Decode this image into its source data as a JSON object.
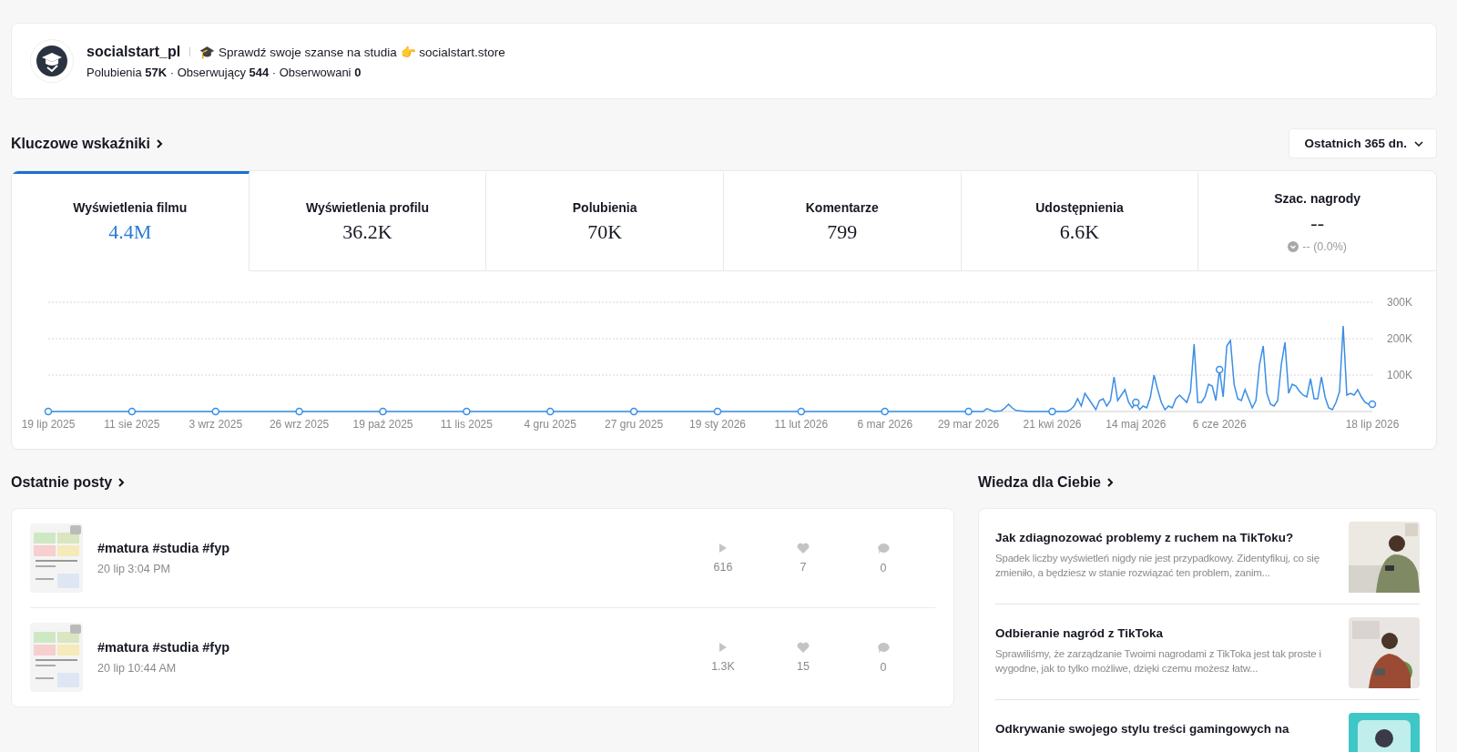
{
  "profile": {
    "username": "socialstart_pl",
    "bio": "🎓 Sprawdź swoje szanse na studia 👉 socialstart.store",
    "stats": "Polubienia **57K** · Obserwujący **544** · Obserwowani **0**"
  },
  "key_metrics": {
    "heading": "Kluczowe wskaźniki",
    "period": "Ostatnich 365 dn.",
    "metrics": [
      {
        "label": "Wyświetlenia filmu",
        "value": "4.4M",
        "selected": true
      },
      {
        "label": "Wyświetlenia profilu",
        "value": "36.2K",
        "selected": false
      },
      {
        "label": "Polubienia",
        "value": "70K",
        "selected": false
      },
      {
        "label": "Komentarze",
        "value": "799",
        "selected": false
      },
      {
        "label": "Udostępnienia",
        "value": "6.6K",
        "selected": false
      },
      {
        "label": "Szac. nagrody",
        "value": "--",
        "change": "-- (0.0%)",
        "selected": false
      }
    ],
    "chart_data": {
      "type": "line",
      "categories": [
        "19 lip 2025",
        null,
        null,
        null,
        null,
        null,
        null,
        null,
        null,
        null,
        null,
        null,
        null,
        null,
        null,
        null,
        null,
        null,
        null,
        null,
        null,
        null,
        null,
        "11 sie 2025",
        null,
        null,
        null,
        null,
        null,
        null,
        null,
        null,
        null,
        null,
        null,
        null,
        null,
        null,
        null,
        null,
        null,
        null,
        null,
        null,
        null,
        null,
        "3 wrz 2025",
        null,
        null,
        null,
        null,
        null,
        null,
        null,
        null,
        null,
        null,
        null,
        null,
        null,
        null,
        null,
        null,
        null,
        null,
        null,
        null,
        null,
        null,
        "26 wrz 2025",
        null,
        null,
        null,
        null,
        null,
        null,
        null,
        null,
        null,
        null,
        null,
        null,
        null,
        null,
        null,
        null,
        null,
        null,
        null,
        null,
        null,
        null,
        "19 paź 2025",
        null,
        null,
        null,
        null,
        null,
        null,
        null,
        null,
        null,
        null,
        null,
        null,
        null,
        null,
        null,
        null,
        null,
        null,
        null,
        null,
        null,
        null,
        "11 lis 2025",
        null,
        null,
        null,
        null,
        null,
        null,
        null,
        null,
        null,
        null,
        null,
        null,
        null,
        null,
        null,
        null,
        null,
        null,
        null,
        null,
        null,
        null,
        "4 gru 2025",
        null,
        null,
        null,
        null,
        null,
        null,
        null,
        null,
        null,
        null,
        null,
        null,
        null,
        null,
        null,
        null,
        null,
        null,
        null,
        null,
        null,
        null,
        "27 gru 2025",
        null,
        null,
        null,
        null,
        null,
        null,
        null,
        null,
        null,
        null,
        null,
        null,
        null,
        null,
        null,
        null,
        null,
        null,
        null,
        null,
        null,
        null,
        "19 sty 2026",
        null,
        null,
        null,
        null,
        null,
        null,
        null,
        null,
        null,
        null,
        null,
        null,
        null,
        null,
        null,
        null,
        null,
        null,
        null,
        null,
        null,
        null,
        "11 lut 2026",
        null,
        null,
        null,
        null,
        null,
        null,
        null,
        null,
        null,
        null,
        null,
        null,
        null,
        null,
        null,
        null,
        null,
        null,
        null,
        null,
        null,
        null,
        "6 mar 2026",
        null,
        null,
        null,
        null,
        null,
        null,
        null,
        null,
        null,
        null,
        null,
        null,
        null,
        null,
        null,
        null,
        null,
        null,
        null,
        null,
        null,
        null,
        "29 mar 2026",
        null,
        null,
        null,
        null,
        null,
        null,
        null,
        null,
        null,
        null,
        null,
        null,
        null,
        null,
        null,
        null,
        null,
        null,
        null,
        null,
        null,
        null,
        "21 kwi 2026",
        null,
        null,
        null,
        null,
        null,
        null,
        null,
        null,
        null,
        null,
        null,
        null,
        null,
        null,
        null,
        null,
        null,
        null,
        null,
        null,
        null,
        null,
        "14 maj 2026",
        null,
        null,
        null,
        null,
        null,
        null,
        null,
        null,
        null,
        null,
        null,
        null,
        null,
        null,
        null,
        null,
        null,
        null,
        null,
        null,
        null,
        null,
        "6 cze 2026",
        null,
        null,
        null,
        null,
        null,
        null,
        null,
        null,
        null,
        null,
        null,
        null,
        null,
        null,
        null,
        null,
        null,
        null,
        null,
        null,
        null,
        null,
        null,
        null,
        null,
        null,
        null,
        null,
        null,
        null,
        null,
        null,
        null,
        null,
        null,
        null,
        null,
        null,
        null,
        null,
        null,
        "18 lip 2026"
      ],
      "series": [
        {
          "color": "#3a8ee6",
          "values": [
            0,
            0,
            0,
            0,
            0,
            0,
            0,
            0,
            0,
            0,
            0,
            0,
            0,
            0,
            0,
            0,
            0,
            0,
            0,
            0,
            0,
            0,
            0,
            0,
            0,
            0,
            0,
            0,
            0,
            0,
            0,
            0,
            0,
            0,
            0,
            0,
            0,
            0,
            0,
            0,
            0,
            0,
            0,
            0,
            0,
            0,
            0,
            0,
            0,
            0,
            0,
            0,
            0,
            0,
            0,
            0,
            0,
            0,
            0,
            0,
            0,
            0,
            0,
            0,
            0,
            0,
            0,
            0,
            0,
            0,
            0,
            0,
            0,
            0,
            0,
            0,
            0,
            0,
            0,
            0,
            0,
            0,
            0,
            0,
            0,
            0,
            0,
            0,
            0,
            0,
            0,
            0,
            0,
            0,
            0,
            0,
            0,
            0,
            0,
            0,
            0,
            0,
            0,
            0,
            0,
            0,
            0,
            0,
            0,
            0,
            0,
            0,
            0,
            0,
            0,
            0,
            0,
            0,
            0,
            0,
            0,
            0,
            0,
            0,
            0,
            0,
            0,
            0,
            0,
            0,
            0,
            0,
            0,
            0,
            0,
            0,
            0,
            0,
            0,
            0,
            0,
            0,
            0,
            0,
            0,
            0,
            0,
            0,
            0,
            0,
            0,
            0,
            0,
            0,
            0,
            0,
            0,
            0,
            0,
            0,
            0,
            0,
            0,
            0,
            0,
            0,
            0,
            0,
            0,
            0,
            0,
            0,
            0,
            0,
            0,
            0,
            0,
            0,
            0,
            0,
            0,
            0,
            0,
            0,
            0,
            0,
            0,
            0,
            0,
            0,
            0,
            0,
            0,
            0,
            0,
            0,
            0,
            0,
            0,
            0,
            0,
            0,
            0,
            0,
            0,
            0,
            0,
            0,
            0,
            0,
            0,
            0,
            0,
            0,
            0,
            0,
            0,
            0,
            0,
            0,
            0,
            0,
            0,
            0,
            0,
            0,
            0,
            0,
            0,
            0,
            0,
            0,
            0,
            0,
            0,
            0,
            0,
            0,
            0,
            0,
            0,
            0,
            0,
            0,
            0,
            0,
            0,
            0,
            0,
            0,
            0,
            0,
            0,
            0,
            0,
            0,
            0,
            0,
            8000,
            4000,
            0,
            1000,
            2000,
            10000,
            20000,
            10000,
            3000,
            2000,
            1000,
            0,
            0,
            0,
            0,
            0,
            0,
            0,
            0,
            0,
            0,
            0,
            0,
            5000,
            15000,
            35000,
            15000,
            50000,
            35000,
            20000,
            5000,
            30000,
            35000,
            15000,
            30000,
            95000,
            30000,
            45000,
            60000,
            25000,
            10000,
            25000,
            5000,
            15000,
            10000,
            40000,
            100000,
            60000,
            25000,
            5000,
            15000,
            10000,
            35000,
            45000,
            35000,
            25000,
            55000,
            185000,
            25000,
            25000,
            40000,
            75000,
            70000,
            30000,
            115000,
            40000,
            180000,
            195000,
            75000,
            35000,
            30000,
            60000,
            35000,
            10000,
            30000,
            130000,
            180000,
            50000,
            20000,
            15000,
            30000,
            130000,
            190000,
            50000,
            75000,
            70000,
            55000,
            45000,
            40000,
            90000,
            35000,
            35000,
            95000,
            40000,
            10000,
            5000,
            25000,
            55000,
            235000,
            45000,
            50000,
            45000,
            60000,
            40000,
            25000,
            20000,
            20000
          ]
        }
      ],
      "yticks": [
        {
          "value": 100000,
          "label": "100K"
        },
        {
          "value": 200000,
          "label": "200K"
        },
        {
          "value": 300000,
          "label": "300K"
        }
      ],
      "ylim": [
        0,
        300000
      ]
    }
  },
  "recent_posts": {
    "heading": "Ostatnie posty",
    "posts": [
      {
        "caption": "#matura #studia #fyp",
        "date": "20 lip 3:04 PM",
        "views": "616",
        "likes": "7",
        "comments": "0"
      },
      {
        "caption": "#matura #studia #fyp",
        "date": "20 lip 10:44 AM",
        "views": "1.3K",
        "likes": "15",
        "comments": "0"
      }
    ]
  },
  "knowledge": {
    "heading": "Wiedza dla Ciebie",
    "articles": [
      {
        "title": "Jak zdiagnozować problemy z ruchem na TikToku?",
        "summary": "Spadek liczby wyświetleń nigdy nie jest przypadkowy. Zidentyfikuj, co się zmieniło, a będziesz w stanie rozwiązać ten problem, zanim..."
      },
      {
        "title": "Odbieranie nagród z TikToka",
        "summary": "Sprawiliśmy, że zarządzanie Twoimi nagrodami z TikToka jest tak proste i wygodne, jak to tylko możliwe, dzięki czemu możesz łatw..."
      },
      {
        "title": "Odkrywanie swojego stylu treści gamingowych na"
      }
    ]
  }
}
